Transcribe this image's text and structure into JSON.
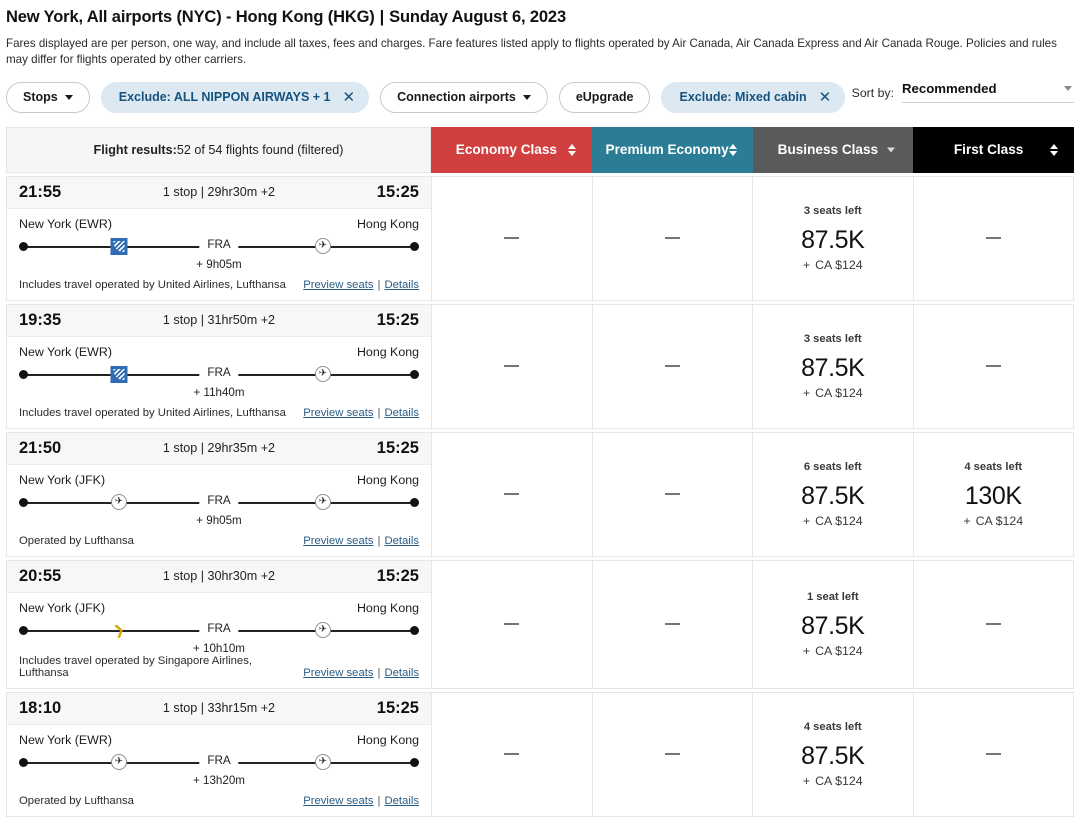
{
  "header": {
    "route_title": "New York, All airports (NYC) - Hong Kong (HKG)",
    "separator": "|",
    "date": "Sunday August 6, 2023",
    "fare_note": "Fares displayed are per person, one way, and include all taxes, fees and charges. Fare features listed apply to flights operated by Air Canada, Air Canada Express and Air Canada Rouge. Policies and rules may differ for flights operated by other carriers."
  },
  "filters": {
    "chips": [
      {
        "label": "Stops",
        "type": "dropdown",
        "active": false
      },
      {
        "label": "Exclude: ALL NIPPON AIRWAYS + 1",
        "type": "removable",
        "active": true
      },
      {
        "label": "Connection airports",
        "type": "dropdown",
        "active": false
      },
      {
        "label": "eUpgrade",
        "type": "plain",
        "active": false
      },
      {
        "label": "Exclude: Mixed cabin",
        "type": "removable",
        "active": true
      }
    ],
    "sort": {
      "label": "Sort by:",
      "value": "Recommended"
    }
  },
  "table": {
    "summary_label": "Flight results:",
    "summary_value": "52 of 54 flights found (filtered)",
    "columns": [
      {
        "label": "Economy Class",
        "color": "#d23f3f",
        "control": "sort"
      },
      {
        "label": "Premium Economy",
        "color": "#2b7d96",
        "control": "sort"
      },
      {
        "label": "Business Class",
        "color": "#5a5a5a",
        "control": "caret"
      },
      {
        "label": "First Class",
        "color": "#000000",
        "control": "sort"
      }
    ]
  },
  "rows": [
    {
      "depart": "21:55",
      "duration": "1 stop | 29hr30m +2",
      "arrive": "15:25",
      "origin": "New York (EWR)",
      "destination": "Hong Kong",
      "connection": "FRA",
      "layover": "+ 9h05m",
      "operated": "Includes travel operated by United Airlines, Lufthansa",
      "preview_label": "Preview seats",
      "details_label": "Details",
      "marks": [
        {
          "airline": "ua",
          "pos": 25
        },
        {
          "airline": "lh",
          "pos": 76
        }
      ],
      "fares": [
        {
          "cabin": "Economy Class",
          "available": false
        },
        {
          "cabin": "Premium Economy",
          "available": false
        },
        {
          "cabin": "Business Class",
          "available": true,
          "seats": "3 seats left",
          "points": "87.5K",
          "plus": "+",
          "cash": "CA $124"
        },
        {
          "cabin": "First Class",
          "available": false
        }
      ]
    },
    {
      "depart": "19:35",
      "duration": "1 stop | 31hr50m +2",
      "arrive": "15:25",
      "origin": "New York (EWR)",
      "destination": "Hong Kong",
      "connection": "FRA",
      "layover": "+ 11h40m",
      "operated": "Includes travel operated by United Airlines, Lufthansa",
      "preview_label": "Preview seats",
      "details_label": "Details",
      "marks": [
        {
          "airline": "ua",
          "pos": 25
        },
        {
          "airline": "lh",
          "pos": 76
        }
      ],
      "fares": [
        {
          "cabin": "Economy Class",
          "available": false
        },
        {
          "cabin": "Premium Economy",
          "available": false
        },
        {
          "cabin": "Business Class",
          "available": true,
          "seats": "3 seats left",
          "points": "87.5K",
          "plus": "+",
          "cash": "CA $124"
        },
        {
          "cabin": "First Class",
          "available": false
        }
      ]
    },
    {
      "depart": "21:50",
      "duration": "1 stop | 29hr35m +2",
      "arrive": "15:25",
      "origin": "New York (JFK)",
      "destination": "Hong Kong",
      "connection": "FRA",
      "layover": "+ 9h05m",
      "operated": "Operated by Lufthansa",
      "preview_label": "Preview seats",
      "details_label": "Details",
      "marks": [
        {
          "airline": "lh",
          "pos": 25
        },
        {
          "airline": "lh",
          "pos": 76
        }
      ],
      "fares": [
        {
          "cabin": "Economy Class",
          "available": false
        },
        {
          "cabin": "Premium Economy",
          "available": false
        },
        {
          "cabin": "Business Class",
          "available": true,
          "seats": "6 seats left",
          "points": "87.5K",
          "plus": "+",
          "cash": "CA $124"
        },
        {
          "cabin": "First Class",
          "available": true,
          "seats": "4 seats left",
          "points": "130K",
          "plus": "+",
          "cash": "CA $124"
        }
      ]
    },
    {
      "depart": "20:55",
      "duration": "1 stop | 30hr30m +2",
      "arrive": "15:25",
      "origin": "New York (JFK)",
      "destination": "Hong Kong",
      "connection": "FRA",
      "layover": "+ 10h10m",
      "operated": "Includes travel operated by Singapore Airlines, Lufthansa",
      "preview_label": "Preview seats",
      "details_label": "Details",
      "marks": [
        {
          "airline": "sq",
          "pos": 25
        },
        {
          "airline": "lh",
          "pos": 76
        }
      ],
      "fares": [
        {
          "cabin": "Economy Class",
          "available": false
        },
        {
          "cabin": "Premium Economy",
          "available": false
        },
        {
          "cabin": "Business Class",
          "available": true,
          "seats": "1 seat left",
          "points": "87.5K",
          "plus": "+",
          "cash": "CA $124"
        },
        {
          "cabin": "First Class",
          "available": false
        }
      ]
    },
    {
      "depart": "18:10",
      "duration": "1 stop | 33hr15m +2",
      "arrive": "15:25",
      "origin": "New York (EWR)",
      "destination": "Hong Kong",
      "connection": "FRA",
      "layover": "+ 13h20m",
      "operated": "Operated by Lufthansa",
      "preview_label": "Preview seats",
      "details_label": "Details",
      "marks": [
        {
          "airline": "lh",
          "pos": 25
        },
        {
          "airline": "lh",
          "pos": 76
        }
      ],
      "fares": [
        {
          "cabin": "Economy Class",
          "available": false
        },
        {
          "cabin": "Premium Economy",
          "available": false
        },
        {
          "cabin": "Business Class",
          "available": true,
          "seats": "4 seats left",
          "points": "87.5K",
          "plus": "+",
          "cash": "CA $124"
        },
        {
          "cabin": "First Class",
          "available": false
        }
      ]
    }
  ],
  "icons": {
    "unavailable_dash": "—",
    "lufthansa_crane": "✈",
    "singapore_bird": "❯"
  }
}
